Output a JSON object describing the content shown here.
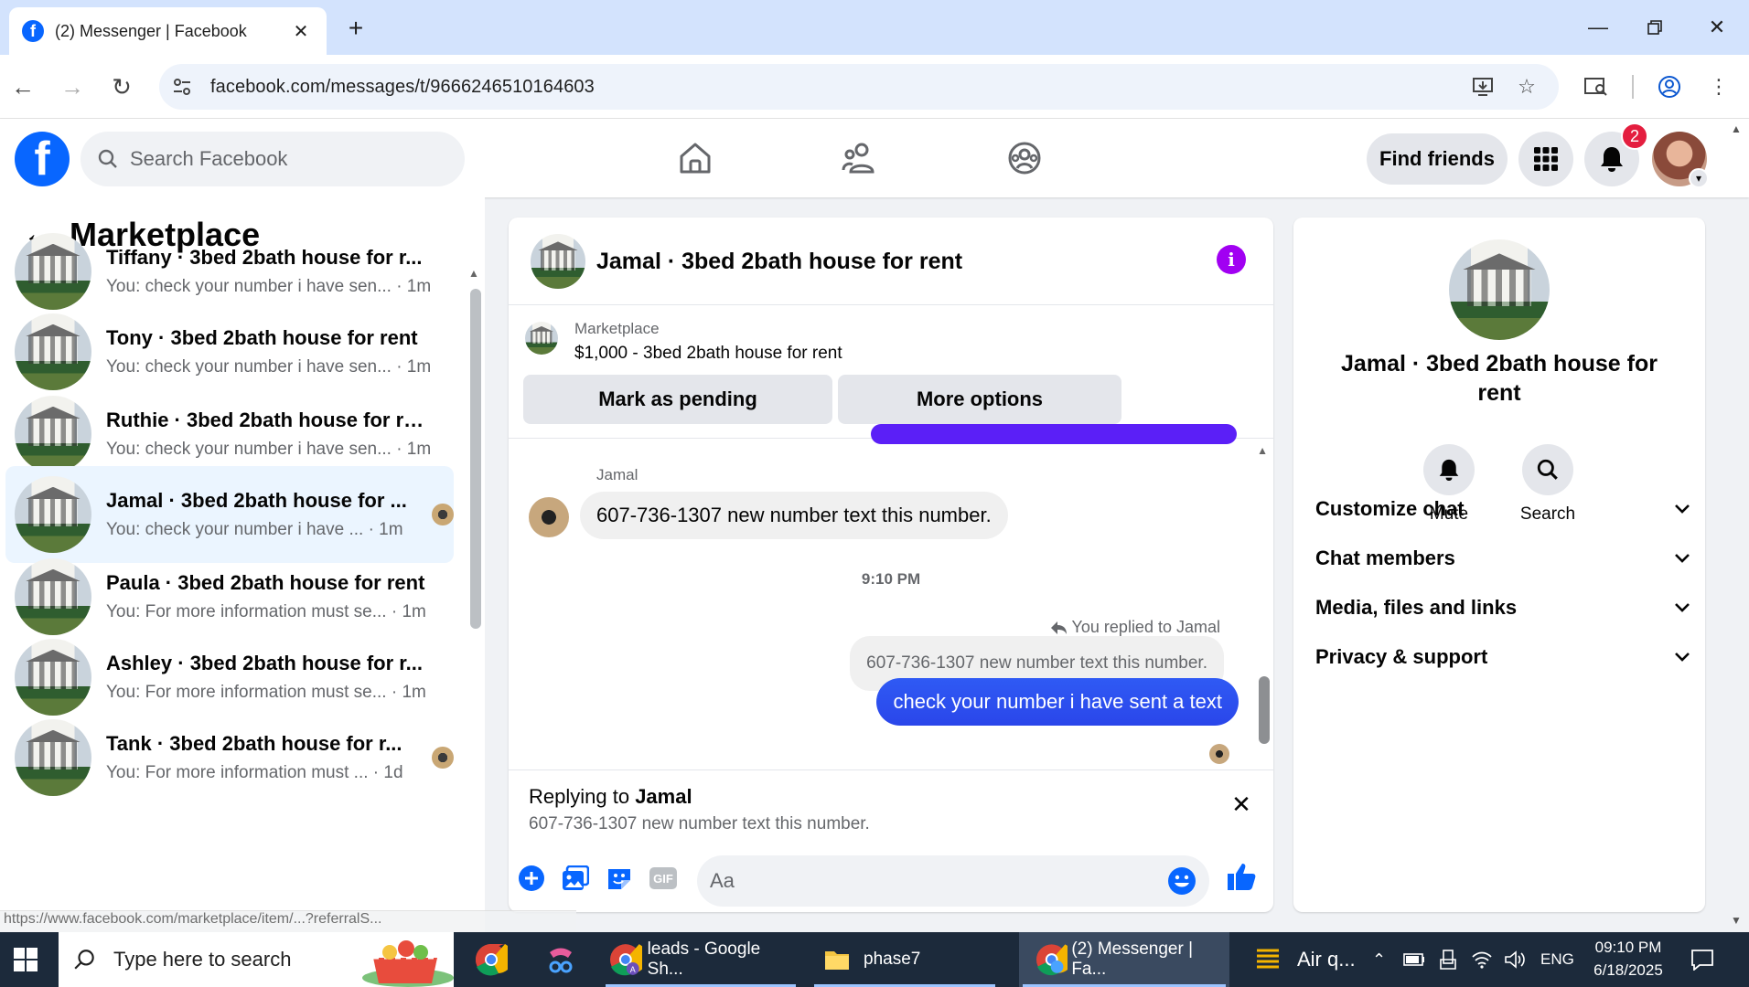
{
  "browser": {
    "tab_title": "(2) Messenger | Facebook",
    "url": "facebook.com/messages/t/9666246510164603",
    "status_url": "https://www.facebook.com/marketplace/item/...?referralS..."
  },
  "fb_header": {
    "search_placeholder": "Search Facebook",
    "find_friends": "Find friends",
    "notification_count": "2"
  },
  "sidebar": {
    "title": "Marketplace",
    "conversations": [
      {
        "name": "Tiffany · 3bed 2bath house for r...",
        "preview": "You: check your number i have sen... · 1m"
      },
      {
        "name": "Tony · 3bed 2bath house for rent",
        "preview": "You: check your number i have sen... · 1m"
      },
      {
        "name": "Ruthie · 3bed 2bath house for re...",
        "preview": "You: check your number i have sen... · 1m"
      },
      {
        "name": "Jamal · 3bed 2bath house for ...",
        "preview": "You: check your number i have ... · 1m"
      },
      {
        "name": "Paula · 3bed 2bath house for rent",
        "preview": "You: For more information must se... · 1m"
      },
      {
        "name": "Ashley · 3bed 2bath house for r...",
        "preview": "You: For more information must se... · 1m"
      },
      {
        "name": "Tank · 3bed 2bath house for r...",
        "preview": "You: For more information must ... · 1d"
      }
    ]
  },
  "chat": {
    "title": "Jamal · 3bed 2bath house for rent",
    "listing_source": "Marketplace",
    "listing_item": "$1,000 - 3bed 2bath house for rent",
    "mark_pending": "Mark as pending",
    "more_options": "More options",
    "sender_name": "Jamal",
    "incoming_message": "607-736-1307 new number text this number.",
    "timestamp": "9:10 PM",
    "replied_label": "You replied to Jamal",
    "quoted_message": "607-736-1307 new number text this number.",
    "outgoing_message": "check your number i have sent a text",
    "reply_bar_prefix": "Replying to ",
    "reply_bar_name": "Jamal",
    "reply_bar_quote": "607-736-1307 new number text this number.",
    "input_placeholder": "Aa"
  },
  "details": {
    "name": "Jamal · 3bed 2bath house for rent",
    "mute_label": "Mute",
    "search_label": "Search",
    "sections": [
      "Customize chat",
      "Chat members",
      "Media, files and links",
      "Privacy & support"
    ]
  },
  "taskbar": {
    "search_placeholder": "Type here to search",
    "app_sheets": "leads - Google Sh...",
    "app_folder": "phase7",
    "app_messenger": "(2) Messenger | Fa...",
    "air_quality": "Air q...",
    "language": "ENG",
    "time": "09:10 PM",
    "date": "6/18/2025"
  },
  "colors": {
    "fb_blue": "#0866ff",
    "messenger_bubble": "#2f5af4",
    "active_conversation_bg": "#ebf5ff",
    "info_purple": "#a100f2",
    "notification_red": "#e41e3f"
  }
}
